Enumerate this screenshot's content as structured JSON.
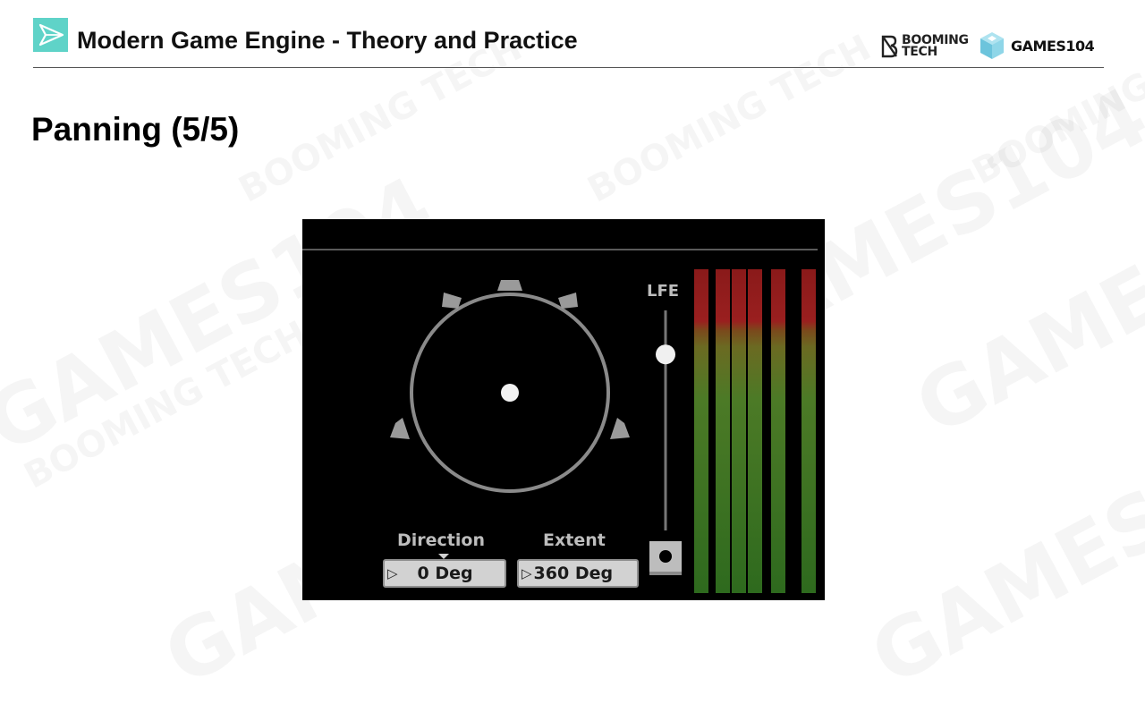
{
  "header": {
    "title": "Modern Game Engine - Theory and Practice",
    "brand_booming": [
      "BOOMING",
      "TECH"
    ],
    "brand_games": "GAMES104"
  },
  "slide": {
    "title": "Panning (5/5)"
  },
  "panner": {
    "lfe_label": "LFE",
    "lfe_level": 0.8,
    "direction": {
      "label": "Direction",
      "value": "0 Deg"
    },
    "extent": {
      "label": "Extent",
      "value": "360 Deg"
    },
    "meter_channels": 6
  },
  "watermarks": [
    "GAMES104",
    "BOOMING TECH"
  ]
}
